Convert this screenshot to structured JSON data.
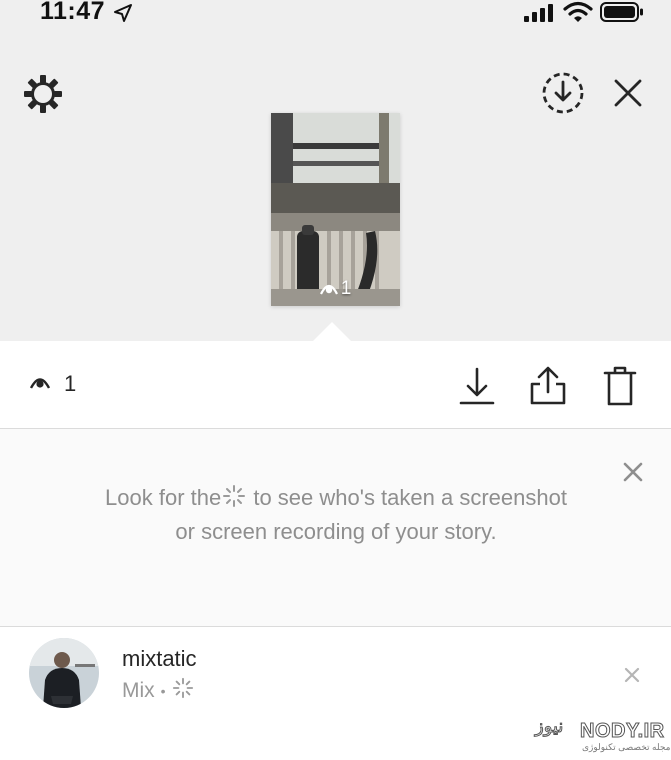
{
  "status_bar": {
    "time": "11:47"
  },
  "story": {
    "view_count": "1"
  },
  "action_bar": {
    "view_count": "1"
  },
  "tip": {
    "text_before": "Look for the",
    "text_after": "to see who's taken a screenshot or screen recording of your story."
  },
  "viewers": [
    {
      "username": "mixtatic",
      "subtitle": "Mix",
      "separator": "•"
    }
  ],
  "watermark": {
    "text": "NODY.IR",
    "text_fa": "نیوز",
    "subtext": "مجله تخصصی تکنولوژی"
  },
  "colors": {
    "top_background": "#efefef",
    "secondary_text": "#8e8e8e",
    "divider": "#dbdbdb"
  }
}
